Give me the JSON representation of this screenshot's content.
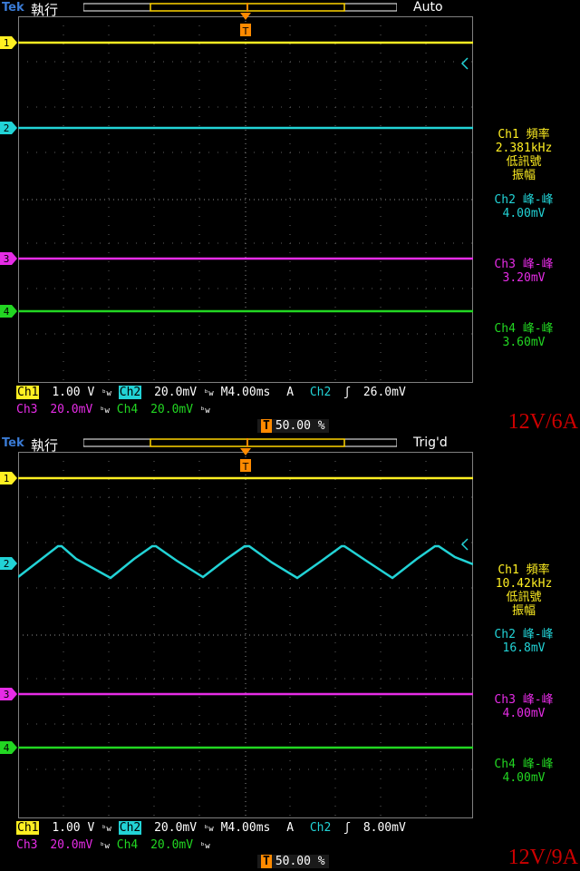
{
  "caption_top": "12V/6A",
  "caption_bottom": "12V/9A",
  "colors": {
    "ch1": "#ffef22",
    "ch2": "#22d3d6",
    "ch3": "#e62ce6",
    "ch4": "#22d622",
    "caption": "#cc0000"
  },
  "panels": [
    {
      "brand": "Tek",
      "run_state": "執行",
      "trigger_state": "Auto",
      "ch_markers": [
        "1",
        "2",
        "3",
        "4"
      ],
      "meas": {
        "ch1_title": "Ch1 頻率",
        "ch1_value": "2.381kHz",
        "ch1_note1": "低訊號",
        "ch1_note2": "振幅",
        "ch2_title": "Ch2 峰-峰",
        "ch2_value": "4.00mV",
        "ch3_title": "Ch3 峰-峰",
        "ch3_value": "3.20mV",
        "ch4_title": "Ch4 峰-峰",
        "ch4_value": "3.60mV"
      },
      "status": {
        "ch1": "Ch1",
        "ch1_scale": "1.00 V",
        "ch2": "Ch2",
        "ch2_scale": "20.0mV",
        "ch3": "Ch3",
        "ch3_scale": "20.0mV",
        "ch4": "Ch4",
        "ch4_scale": "20.0mV",
        "bw_symbol": "ᵇw",
        "timebase": "M4.00ms",
        "trig_mode": "A",
        "trig_source": "Ch2",
        "trig_level": "26.0mV",
        "trig_pos": "50.00 %"
      }
    },
    {
      "brand": "Tek",
      "run_state": "執行",
      "trigger_state": "Trig'd",
      "ch_markers": [
        "1",
        "2",
        "3",
        "4"
      ],
      "meas": {
        "ch1_title": "Ch1 頻率",
        "ch1_value": "10.42kHz",
        "ch1_note1": "低訊號",
        "ch1_note2": "振幅",
        "ch2_title": "Ch2 峰-峰",
        "ch2_value": "16.8mV",
        "ch3_title": "Ch3 峰-峰",
        "ch3_value": "4.00mV",
        "ch4_title": "Ch4 峰-峰",
        "ch4_value": "4.00mV"
      },
      "status": {
        "ch1": "Ch1",
        "ch1_scale": "1.00 V",
        "ch2": "Ch2",
        "ch2_scale": "20.0mV",
        "ch3": "Ch3",
        "ch3_scale": "20.0mV",
        "ch4": "Ch4",
        "ch4_scale": "20.0mV",
        "bw_symbol": "ᵇw",
        "timebase": "M4.00ms",
        "trig_mode": "A",
        "trig_source": "Ch2",
        "trig_level": "8.00mV",
        "trig_pos": "50.00 %"
      }
    }
  ]
}
